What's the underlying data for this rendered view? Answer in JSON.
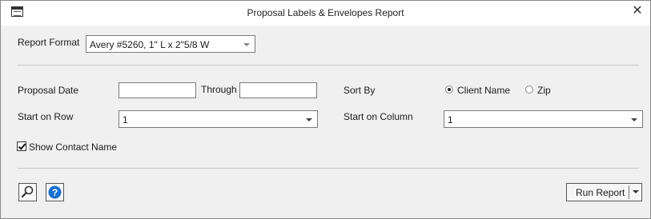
{
  "window": {
    "title": "Proposal Labels & Envelopes Report",
    "close_glyph": "✕"
  },
  "report_format": {
    "label": "Report Format",
    "selected": "Avery #5260, 1\" L x 2\"5/8 W"
  },
  "proposal_date": {
    "label": "Proposal Date",
    "from_value": "",
    "through_label": "Through",
    "through_value": ""
  },
  "sort_by": {
    "label": "Sort By",
    "options": [
      {
        "label": "Client Name",
        "selected": true
      },
      {
        "label": "Zip",
        "selected": false
      }
    ]
  },
  "start_row": {
    "label": "Start on Row",
    "selected": "1"
  },
  "start_column": {
    "label": "Start on Column",
    "selected": "1"
  },
  "show_contact_name": {
    "label": "Show Contact Name",
    "checked": true
  },
  "footer": {
    "search_icon": "magnifier-icon",
    "help_icon": "help-icon",
    "run_label": "Run Report"
  },
  "colors": {
    "help_blue": "#1a6fd1",
    "dialog_bg": "#f0f0f0"
  }
}
